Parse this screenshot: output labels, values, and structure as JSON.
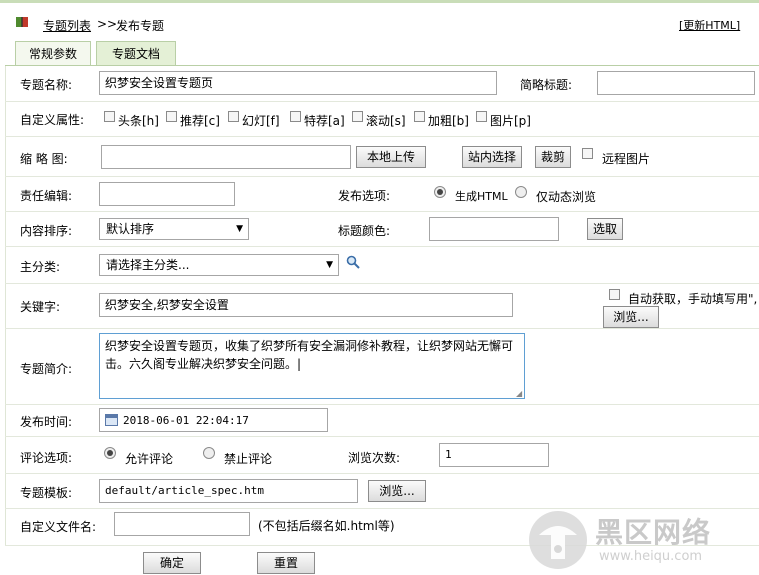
{
  "header": {
    "breadcrumb_link": "专题列表",
    "breadcrumb_sep": ">>",
    "breadcrumb_current": "发布专题",
    "update_html": "[更新HTML]"
  },
  "tabs": [
    {
      "label": "常规参数"
    },
    {
      "label": "专题文档"
    }
  ],
  "form": {
    "title_label": "专题名称:",
    "title_value": "织梦安全设置专题页",
    "short_title_label": "简略标题:",
    "short_title_value": "",
    "attr_label": "自定义属性:",
    "attrs": [
      "头条[h]",
      "推荐[c]",
      "幻灯[f]",
      "特荐[a]",
      "滚动[s]",
      "加粗[b]",
      "图片[p]"
    ],
    "thumb_label": "缩 略 图:",
    "thumb_value": "",
    "upload_btn": "本地上传",
    "site_select_btn": "站内选择",
    "crop_btn": "裁剪",
    "remote_img": "远程图片",
    "editor_label": "责任编辑:",
    "editor_value": "",
    "publish_label": "发布选项:",
    "publish_html": "生成HTML",
    "publish_dynamic": "仅动态浏览",
    "sort_label": "内容排序:",
    "sort_value": "默认排序",
    "color_label": "标题颜色:",
    "color_value": "",
    "color_btn": "选取",
    "category_label": "主分类:",
    "category_value": "请选择主分类...",
    "keywords_label": "关键字:",
    "keywords_value": "织梦安全,织梦安全设置",
    "auto_keywords": "自动获取，手动填写用\",",
    "browse_btn": "浏览...",
    "intro_label": "专题简介:",
    "intro_value": "织梦安全设置专题页，收集了织梦所有安全漏洞修补教程，让织梦网站无懈可击。六久阁专业解决织梦安全问题。|",
    "time_label": "发布时间:",
    "time_value": "2018-06-01 22:04:17",
    "comment_label": "评论选项:",
    "comment_allow": "允许评论",
    "comment_deny": "禁止评论",
    "views_label": "浏览次数:",
    "views_value": "1",
    "template_label": "专题模板:",
    "template_value": "default/article_spec.htm",
    "template_browse_btn": "浏览...",
    "filename_label": "自定义文件名:",
    "filename_value": "",
    "filename_hint": "(不包括后缀名如.html等)"
  },
  "footer": {
    "ok_btn": "确定",
    "reset_btn": "重置"
  },
  "watermark": {
    "text": "黑区网络",
    "url": "www.heiqu.com"
  }
}
